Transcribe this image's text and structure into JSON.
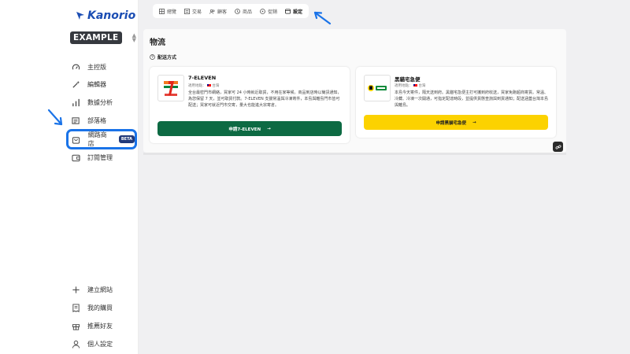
{
  "brand": {
    "name": "Kanorio",
    "color": "#1b4db3"
  },
  "site_switcher": {
    "label": "EXAMPLE"
  },
  "sidebar": {
    "items": [
      {
        "label": "主控版",
        "icon": "gauge-icon"
      },
      {
        "label": "編輯器",
        "icon": "magic-wand-icon"
      },
      {
        "label": "數據分析",
        "icon": "bar-chart-icon"
      },
      {
        "label": "部落格",
        "icon": "newspaper-icon"
      },
      {
        "label": "網路商店",
        "icon": "shopping-bag-icon",
        "badge": "BETA",
        "active": true
      },
      {
        "label": "訂閱管理",
        "icon": "wallet-icon"
      }
    ],
    "bottom_items": [
      {
        "label": "建立網站",
        "icon": "plus-icon"
      },
      {
        "label": "我的購買",
        "icon": "receipt-icon"
      },
      {
        "label": "推薦好友",
        "icon": "gift-icon"
      },
      {
        "label": "個人設定",
        "icon": "user-icon"
      }
    ]
  },
  "topnav": {
    "tabs": [
      {
        "label": "總覽",
        "icon": "grid-icon"
      },
      {
        "label": "交易",
        "icon": "swap-icon"
      },
      {
        "label": "顧客",
        "icon": "users-icon"
      },
      {
        "label": "商品",
        "icon": "tag-icon"
      },
      {
        "label": "促銷",
        "icon": "discount-icon"
      },
      {
        "label": "設定",
        "icon": "settings-box-icon",
        "active": true
      }
    ]
  },
  "page": {
    "title": "物流",
    "section_title": "配送方式"
  },
  "cards": [
    {
      "name": "7-ELEVEN",
      "applicable": "適用地點：",
      "region": "台灣",
      "description": "全台最密門市網絡，買家可 24 小時就近取貨，不用在家等候。商品到店時以簡訊通知，為您保留 7 天，並可取貨付款。7-ELEVEN 支援常溫與冷凍寄件，本島與離島門市皆可配送；買家可就近門市交寄，量大也能進大宗寄倉。",
      "button": "申請7-ELEVEN",
      "button_color": "#0d6a43"
    },
    {
      "name": "黑貓宅急便",
      "applicable": "適用地點：",
      "region": "台灣",
      "description": "本島今天寄件，隔天送到府。黑貓宅急便主打可攜到府收送，買家免跑超商寄貨。常溫、冷藏、冷凍一次開通，可指定配達時段，並提供貨態查詢與到貨通知；配送涵蓋台灣本島與離島。",
      "button": "申請黑貓宅急便",
      "button_color": "#fcd200"
    }
  ],
  "colors": {
    "accent": "#1a73e8",
    "highlight_border": "#1a73e8"
  }
}
